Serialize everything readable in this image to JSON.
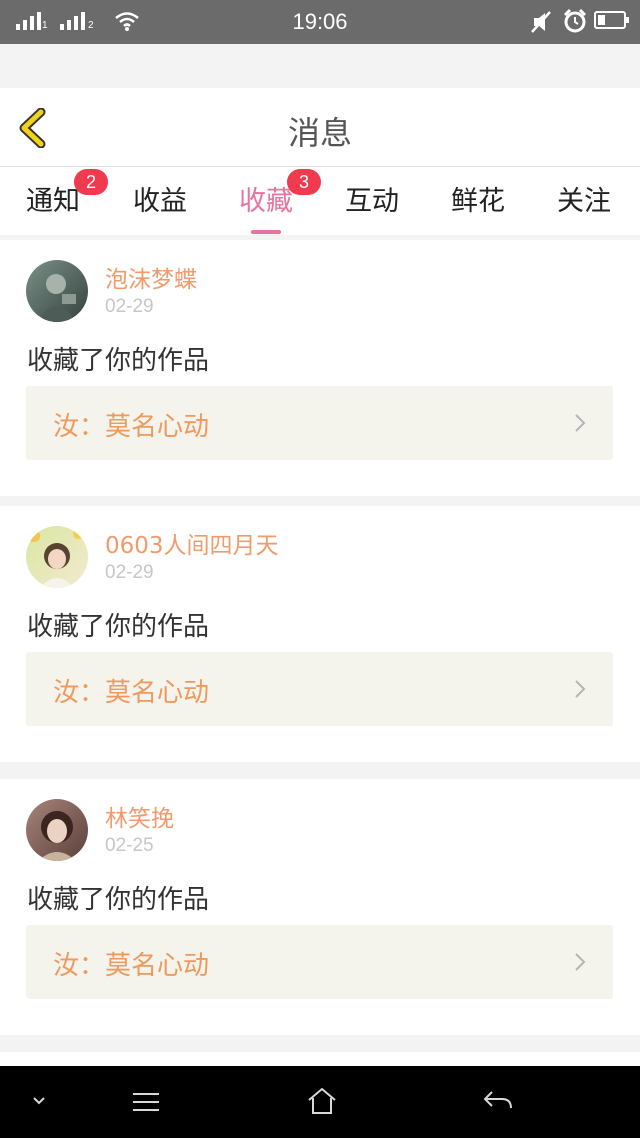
{
  "status_bar": {
    "time": "19:06",
    "sim1": "1",
    "sim2": "2"
  },
  "header": {
    "title": "消息"
  },
  "tabs": [
    {
      "label": "通知",
      "badge": "2"
    },
    {
      "label": "收益"
    },
    {
      "label": "收藏",
      "badge": "3",
      "active": true
    },
    {
      "label": "互动"
    },
    {
      "label": "鲜花"
    },
    {
      "label": "关注"
    }
  ],
  "messages": [
    {
      "user": "泡沫梦蝶",
      "date": "02-29",
      "action": "收藏了你的作品",
      "work_title": "汝：莫名心动"
    },
    {
      "user": "0603人间四月天",
      "date": "02-29",
      "action": "收藏了你的作品",
      "work_title": "汝：莫名心动"
    },
    {
      "user": "林笑挽",
      "date": "02-25",
      "action": "收藏了你的作品",
      "work_title": "汝：莫名心动"
    }
  ],
  "colors": {
    "accent": "#e8739e",
    "username": "#f09b6c",
    "work_title": "#ee9a5e",
    "badge": "#f03a4d",
    "back_arrow": "#f2d318"
  },
  "icons": {
    "back": "chevron-left-icon",
    "work_link": "chevron-right-icon",
    "nav": [
      "chevron-down-icon",
      "menu-icon",
      "home-icon",
      "back-icon"
    ]
  }
}
